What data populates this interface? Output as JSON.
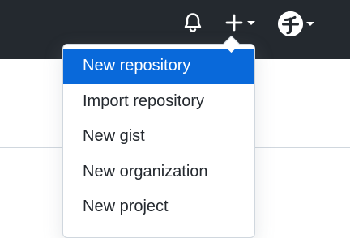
{
  "header": {
    "background_color": "#24292f",
    "icons": {
      "bell": "bell-icon",
      "plus": "plus-icon",
      "caret": "chevron-down-icon",
      "avatar": "avatar"
    }
  },
  "dropdown": {
    "items": [
      {
        "label": "New repository",
        "active": true
      },
      {
        "label": "Import repository",
        "active": false
      },
      {
        "label": "New gist",
        "active": false
      },
      {
        "label": "New organization",
        "active": false
      },
      {
        "label": "New project",
        "active": false
      }
    ],
    "accent_color": "#0969da",
    "text_color": "#24292f"
  }
}
